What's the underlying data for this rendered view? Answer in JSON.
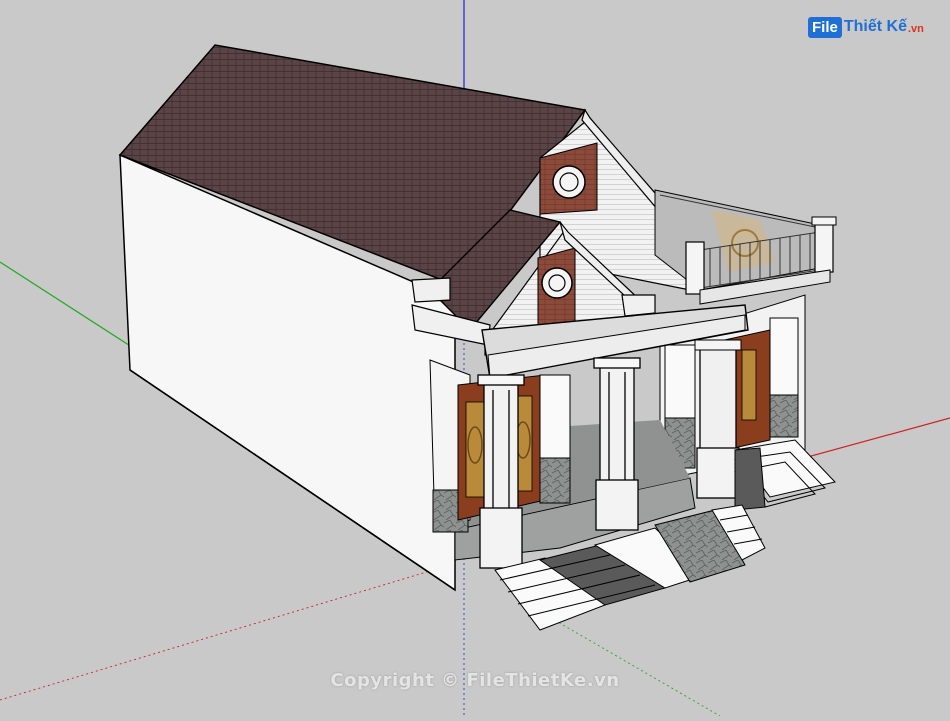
{
  "watermark": {
    "file_text": "File",
    "brand_text": "Thiết Kế",
    "tld_text": ".vn",
    "copyright": "Copyright © FileThietKe.vn"
  },
  "colors": {
    "background": "#c9c9c9",
    "axis_red": "#cc2222",
    "axis_green": "#22aa22",
    "axis_blue": "#2222cc",
    "roof": "#5a4446",
    "brick": "#8b4a3a",
    "door": "#8a3e1e"
  },
  "icons": [
    "axis-x-icon",
    "axis-y-icon",
    "axis-z-icon"
  ]
}
